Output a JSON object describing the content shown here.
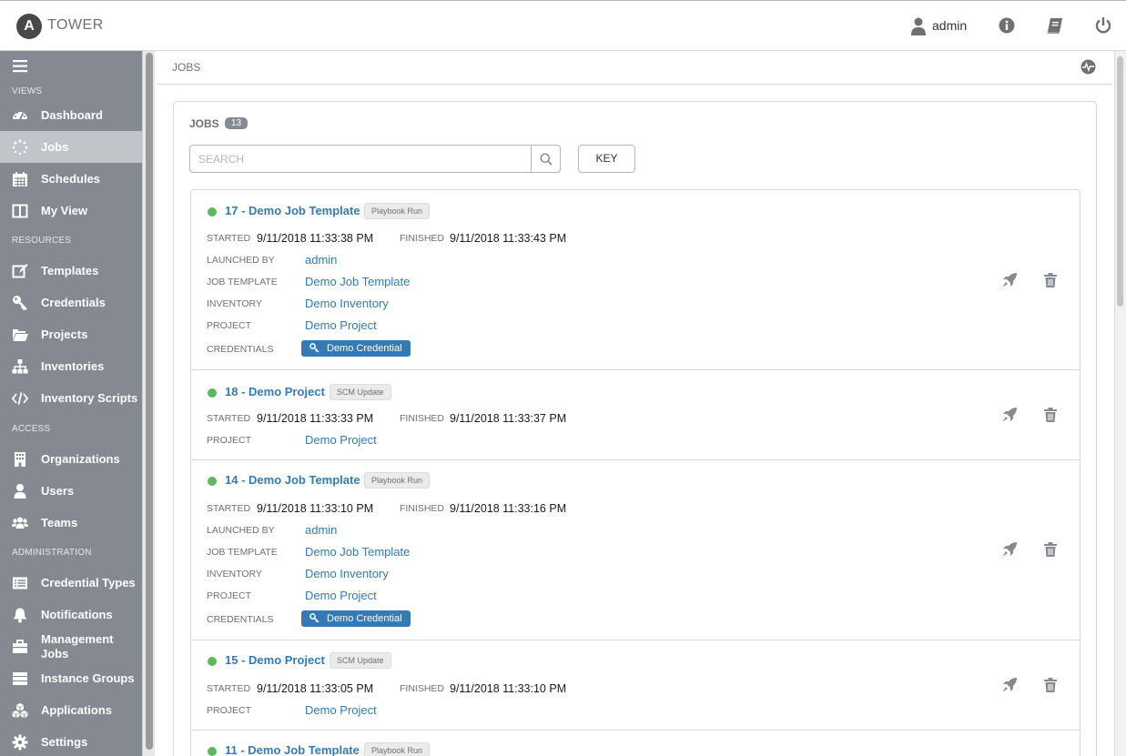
{
  "header": {
    "logo_letter": "A",
    "brand": "TOWER",
    "user": "admin"
  },
  "sidebar": {
    "sections": {
      "views": "VIEWS",
      "resources": "RESOURCES",
      "access": "ACCESS",
      "administration": "ADMINISTRATION"
    },
    "items": [
      {
        "label": "Dashboard",
        "icon": "dashboard-icon"
      },
      {
        "label": "Jobs",
        "icon": "jobs-icon",
        "active": true
      },
      {
        "label": "Schedules",
        "icon": "calendar-icon"
      },
      {
        "label": "My View",
        "icon": "columns-icon"
      },
      {
        "label": "Templates",
        "icon": "edit-icon"
      },
      {
        "label": "Credentials",
        "icon": "key-icon"
      },
      {
        "label": "Projects",
        "icon": "folder-icon"
      },
      {
        "label": "Inventories",
        "icon": "sitemap-icon"
      },
      {
        "label": "Inventory Scripts",
        "icon": "code-icon"
      },
      {
        "label": "Organizations",
        "icon": "building-icon"
      },
      {
        "label": "Users",
        "icon": "user-icon"
      },
      {
        "label": "Teams",
        "icon": "users-icon"
      },
      {
        "label": "Credential Types",
        "icon": "list-alt-icon"
      },
      {
        "label": "Notifications",
        "icon": "bell-icon"
      },
      {
        "label": "Management Jobs",
        "icon": "briefcase-icon"
      },
      {
        "label": "Instance Groups",
        "icon": "server-icon"
      },
      {
        "label": "Applications",
        "icon": "cubes-icon"
      },
      {
        "label": "Settings",
        "icon": "cog-icon"
      }
    ]
  },
  "breadcrumb": "JOBS",
  "panel": {
    "title": "JOBS",
    "count": "13",
    "search_placeholder": "SEARCH",
    "key_label": "KEY"
  },
  "labels": {
    "started": "STARTED",
    "finished": "FINISHED",
    "launched_by": "LAUNCHED BY",
    "job_template": "JOB TEMPLATE",
    "inventory": "INVENTORY",
    "project": "PROJECT",
    "credentials": "CREDENTIALS"
  },
  "jobs": [
    {
      "name": "17 - Demo Job Template",
      "type": "Playbook Run",
      "status": "successful",
      "started": "9/11/2018 11:33:38 PM",
      "finished": "9/11/2018 11:33:43 PM",
      "launched_by": "admin",
      "job_template": "Demo Job Template",
      "inventory": "Demo Inventory",
      "project": "Demo Project",
      "credential": "Demo Credential"
    },
    {
      "name": "18 - Demo Project",
      "type": "SCM Update",
      "status": "successful",
      "started": "9/11/2018 11:33:33 PM",
      "finished": "9/11/2018 11:33:37 PM",
      "project": "Demo Project"
    },
    {
      "name": "14 - Demo Job Template",
      "type": "Playbook Run",
      "status": "successful",
      "started": "9/11/2018 11:33:10 PM",
      "finished": "9/11/2018 11:33:16 PM",
      "launched_by": "admin",
      "job_template": "Demo Job Template",
      "inventory": "Demo Inventory",
      "project": "Demo Project",
      "credential": "Demo Credential"
    },
    {
      "name": "15 - Demo Project",
      "type": "SCM Update",
      "status": "successful",
      "started": "9/11/2018 11:33:05 PM",
      "finished": "9/11/2018 11:33:10 PM",
      "project": "Demo Project"
    },
    {
      "name": "11 - Demo Job Template",
      "type": "Playbook Run",
      "status": "successful"
    }
  ],
  "colors": {
    "sidebar": "#848992",
    "link": "#337ab7",
    "success": "#5cb85c"
  }
}
